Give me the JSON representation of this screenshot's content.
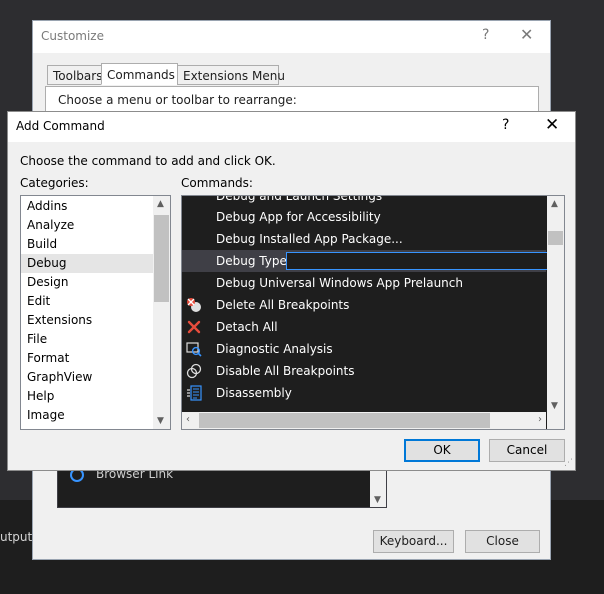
{
  "background": {
    "output_text": "utput t"
  },
  "customize": {
    "title": "Customize",
    "help": "?",
    "close": "✕",
    "tabs": [
      "Toolbars",
      "Commands",
      "Extensions Menu"
    ],
    "prompt": "Choose a menu or toolbar to rearrange:",
    "list_item": "Browser Link",
    "keyboard_button": "Keyboard...",
    "close_button": "Close"
  },
  "add_command": {
    "title": "Add Command",
    "help": "?",
    "close": "✕",
    "instruction": "Choose the command to add and click OK.",
    "categories_label": "Categories:",
    "commands_label": "Commands:",
    "categories": [
      "Addins",
      "Analyze",
      "Build",
      "Debug",
      "Design",
      "Edit",
      "Extensions",
      "File",
      "Format",
      "GraphView",
      "Help",
      "Image"
    ],
    "selected_category": "Debug",
    "commands": [
      {
        "label": "Debug and Launch Settings",
        "icon": ""
      },
      {
        "label": "Debug App for Accessibility",
        "icon": ""
      },
      {
        "label": "Debug Installed App Package...",
        "icon": ""
      },
      {
        "label": "Debug Type",
        "icon": ""
      },
      {
        "label": "Debug Universal Windows App Prelaunch",
        "icon": ""
      },
      {
        "label": "Delete All Breakpoints",
        "icon": "delete-breakpoints-icon"
      },
      {
        "label": "Detach All",
        "icon": "detach-icon"
      },
      {
        "label": "Diagnostic Analysis",
        "icon": "diagnostic-icon"
      },
      {
        "label": "Disable All Breakpoints",
        "icon": "disable-breakpoints-icon"
      },
      {
        "label": "Disassembly",
        "icon": "disassembly-icon"
      }
    ],
    "selected_command": "Debug Type",
    "ok_button": "OK",
    "cancel_button": "Cancel"
  },
  "colors": {
    "accent": "#3794ff",
    "dark_bg": "#1e1e1e",
    "delete_red": "#e74c3c"
  }
}
